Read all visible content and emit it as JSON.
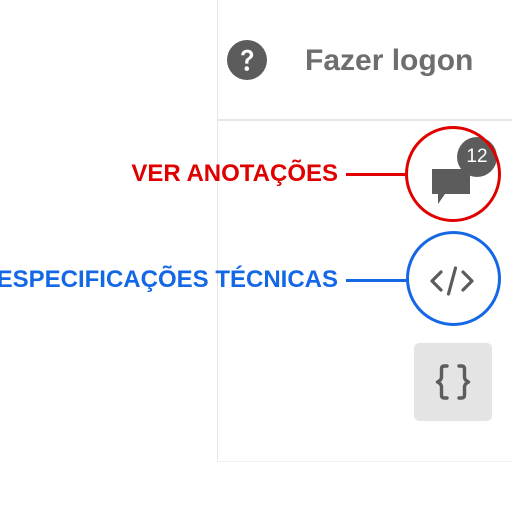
{
  "header": {
    "help_icon": "help-circle-icon",
    "signin_label": "Fazer logon"
  },
  "toolbar": {
    "comments": {
      "icon": "comment-bubble-icon",
      "badge_count": "12"
    },
    "code": {
      "icon": "code-brackets-icon"
    },
    "braces": {
      "icon": "curly-braces-icon",
      "selected": true
    }
  },
  "annotations": {
    "view_comments": {
      "label": "VER ANOTAÇÕES",
      "color": "#e00000"
    },
    "tech_specs": {
      "label": "ESPECIFICAÇÕES TÉCNICAS",
      "color": "#1468e6"
    }
  },
  "colors": {
    "icon_gray": "#5c5c5c",
    "text_gray": "#6e6e6e",
    "selected_bg": "#e4e4e4"
  }
}
